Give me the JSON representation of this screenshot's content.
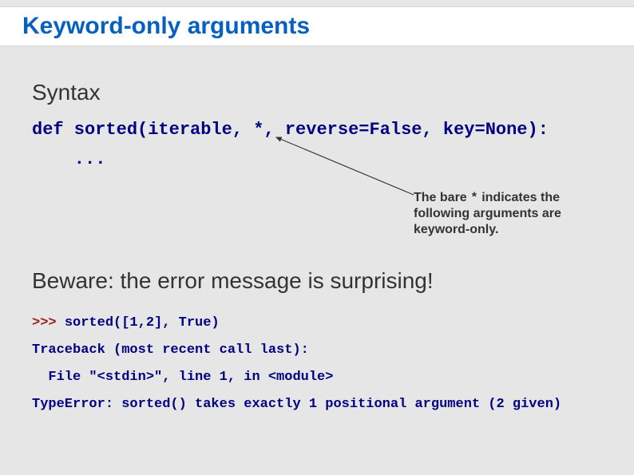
{
  "title": "Keyword-only arguments",
  "syntax": {
    "heading": "Syntax",
    "code_line1": "def sorted(iterable, *, reverse=False, key=None):",
    "code_line2": "    ..."
  },
  "annotation": {
    "pre": "The bare ",
    "star": "*",
    "post": " indicates the following arguments are keyword-only."
  },
  "beware": {
    "heading": "Beware: the error message is surprising!",
    "prompt": ">>> ",
    "input": "sorted([1,2], True)",
    "out1": "Traceback (most recent call last):",
    "out2": "  File \"<stdin>\", line 1, in <module>",
    "out3": "TypeError: sorted() takes exactly 1 positional argument (2 given)"
  }
}
